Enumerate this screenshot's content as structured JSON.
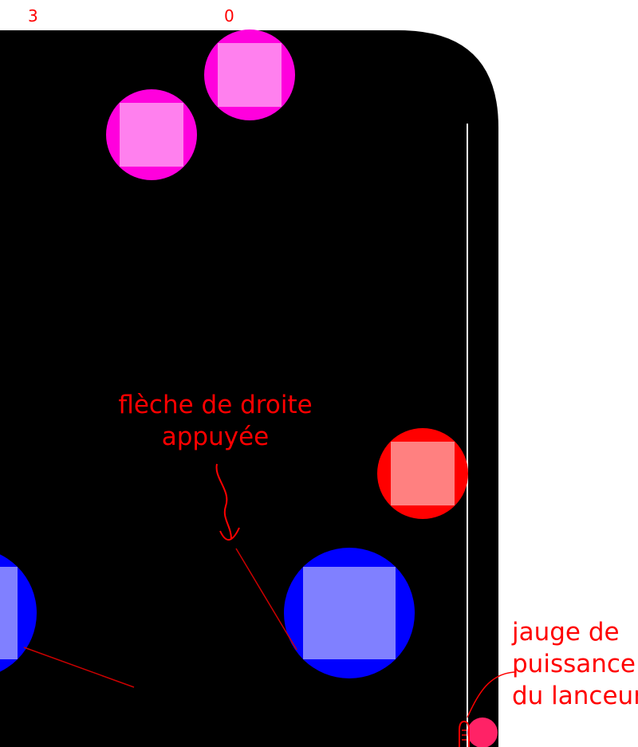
{
  "scores": {
    "left": "3",
    "right": "0"
  },
  "colors": {
    "table": "#000000",
    "magenta": "#ff00dd",
    "magenta_core": "#ff80ee",
    "red": "#ff0000",
    "red_core": "#ff8080",
    "blue": "#0000ff",
    "blue_core": "#8080ff",
    "annotation": "#ff0000"
  },
  "annotations": {
    "arrow_note": [
      "flèche de droite",
      "appuyée"
    ],
    "gauge_note": [
      "jauge de",
      "puissance",
      "du lanceur"
    ]
  }
}
